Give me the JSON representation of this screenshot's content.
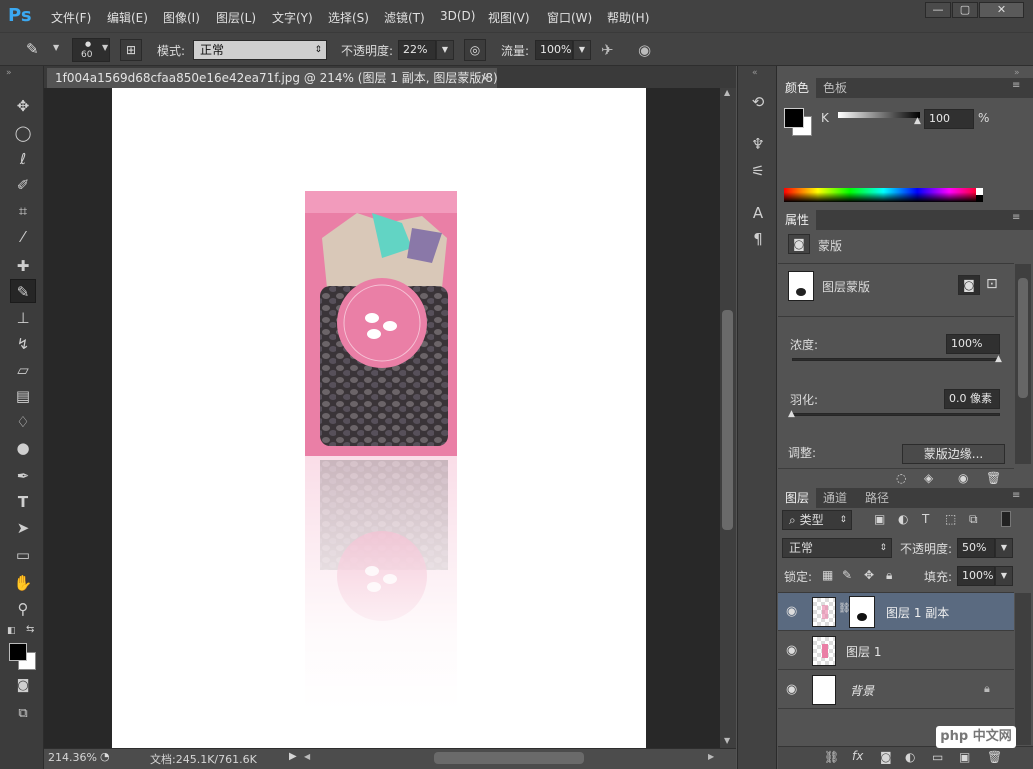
{
  "app": {
    "logo": "Ps"
  },
  "menu": [
    "文件(F)",
    "编辑(E)",
    "图像(I)",
    "图层(L)",
    "文字(Y)",
    "选择(S)",
    "滤镜(T)",
    "3D(D)",
    "视图(V)",
    "窗口(W)",
    "帮助(H)"
  ],
  "window_controls": {
    "minimize": "—",
    "restore": "▢",
    "close": "✕"
  },
  "options": {
    "brush_size": "60",
    "mode_label": "模式:",
    "mode_value": "正常",
    "opacity_label": "不透明度:",
    "opacity_value": "22%",
    "flow_label": "流量:",
    "flow_value": "100%"
  },
  "document": {
    "tab_title": "1f004a1569d68cfaa850e16e42ea71f.jpg @ 214% (图层 1 副本, 图层蒙版/8) *",
    "zoom": "214.36%",
    "doc_info": "文档:245.1K/761.6K"
  },
  "color_panel": {
    "tabs": [
      "颜色",
      "色板"
    ],
    "channel": "K",
    "value": "100",
    "unit": "%"
  },
  "properties_panel": {
    "tab": "属性",
    "section_title": "蒙版",
    "mask_name": "图层蒙版",
    "density_label": "浓度:",
    "density_value": "100%",
    "feather_label": "羽化:",
    "feather_value": "0.0 像素",
    "adjust_label": "调整:",
    "mask_edge_button": "蒙版边缘..."
  },
  "layers_panel": {
    "tabs": [
      "图层",
      "通道",
      "路径"
    ],
    "filter_kind": "类型",
    "blend_mode": "正常",
    "opacity_label": "不透明度:",
    "opacity_value": "50%",
    "lock_label": "锁定:",
    "fill_label": "填充:",
    "fill_value": "100%",
    "layers": [
      {
        "name": "图层 1 副本"
      },
      {
        "name": "图层 1"
      },
      {
        "name": "背景"
      }
    ]
  },
  "watermark": "php 中文网",
  "colors": {
    "accent_blue": "#3ba9f2",
    "selected_layer": "#5a6a80",
    "bag_pink": "#ea7fa6"
  }
}
